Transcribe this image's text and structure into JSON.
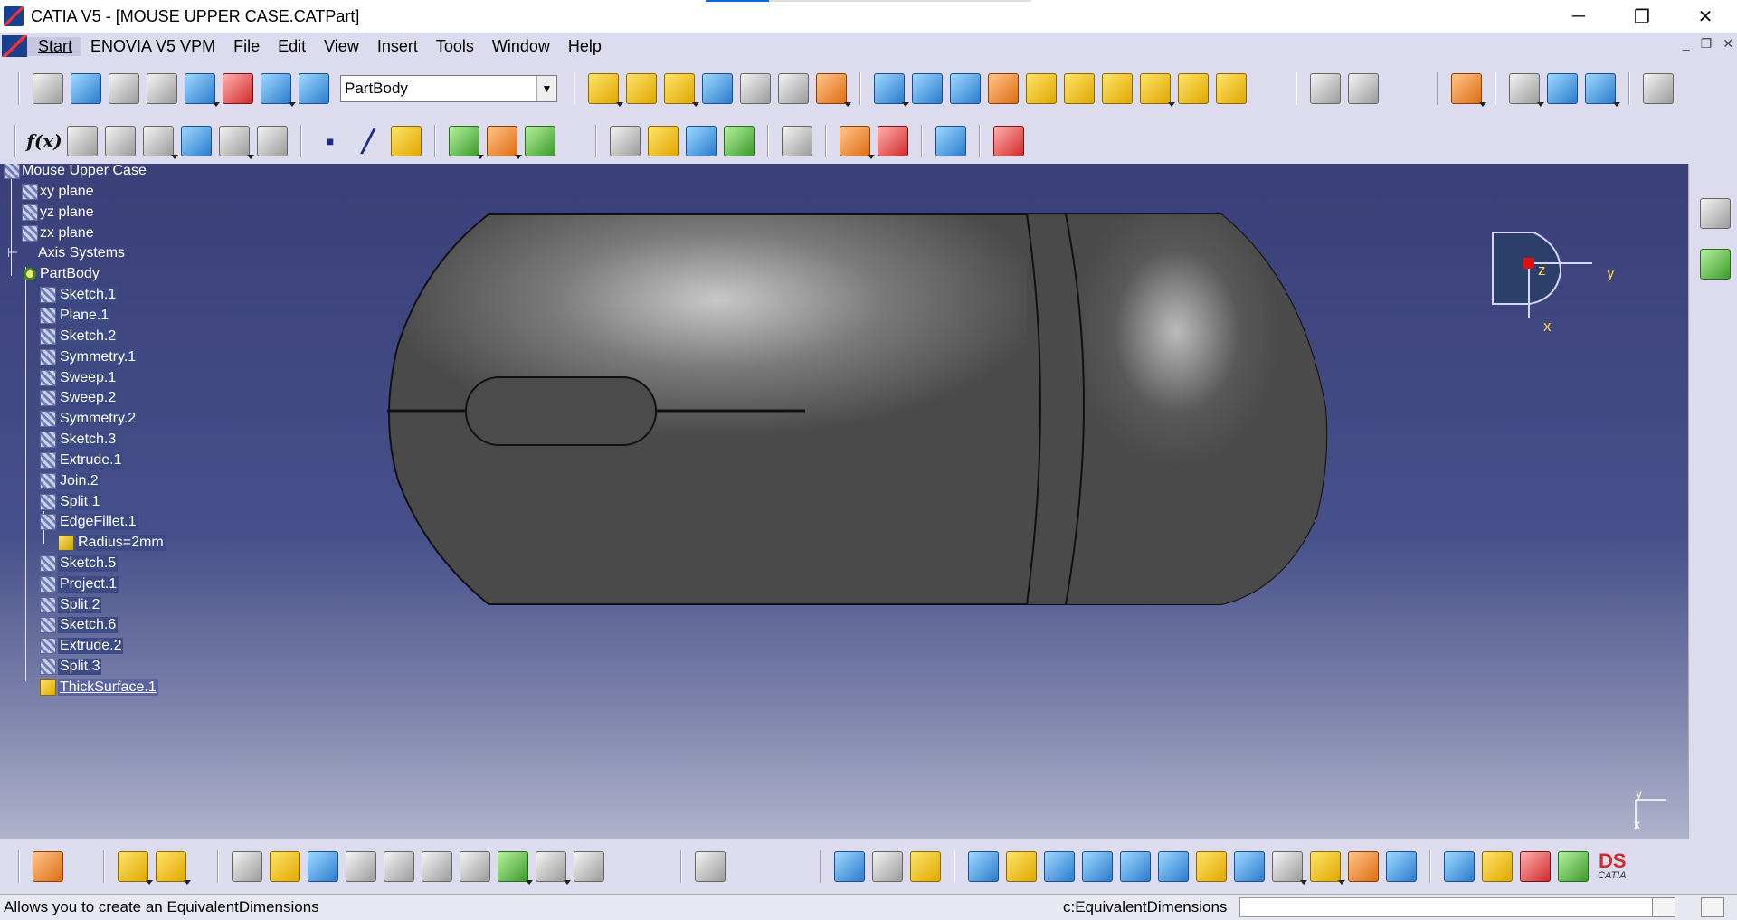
{
  "window": {
    "title": "CATIA V5 - [MOUSE UPPER CASE.CATPart]",
    "minimize": "─",
    "restore": "❐",
    "close": "✕"
  },
  "menu": {
    "items": [
      "Start",
      "ENOVIA V5 VPM",
      "File",
      "Edit",
      "View",
      "Insert",
      "Tools",
      "Window",
      "Help"
    ],
    "mdi": [
      "_",
      "❐",
      "✕"
    ]
  },
  "toolbar": {
    "current_body": "PartBody",
    "formula_label": "f(x)"
  },
  "tree": {
    "root": "Mouse Upper Case",
    "nodes": [
      "xy plane",
      "yz plane",
      "zx plane",
      "Axis Systems",
      "PartBody",
      "Sketch.1",
      "Plane.1",
      "Sketch.2",
      "Symmetry.1",
      "Sweep.1",
      "Sweep.2",
      "Symmetry.2",
      "Sketch.3",
      "Extrude.1",
      "Join.2",
      "Split.1",
      "EdgeFillet.1",
      "Radius=2mm",
      "Sketch.5",
      "Project.1",
      "Split.2",
      "Sketch.6",
      "Extrude.2",
      "Split.3",
      "ThickSurface.1"
    ]
  },
  "compass": {
    "z": "z",
    "y": "y",
    "x": "x"
  },
  "mini_axis": {
    "y": "y",
    "x": "x"
  },
  "status": {
    "message": "Allows you to create an EquivalentDimensions",
    "command": "c:EquivalentDimensions"
  },
  "brand": {
    "logo": "CATIA"
  }
}
